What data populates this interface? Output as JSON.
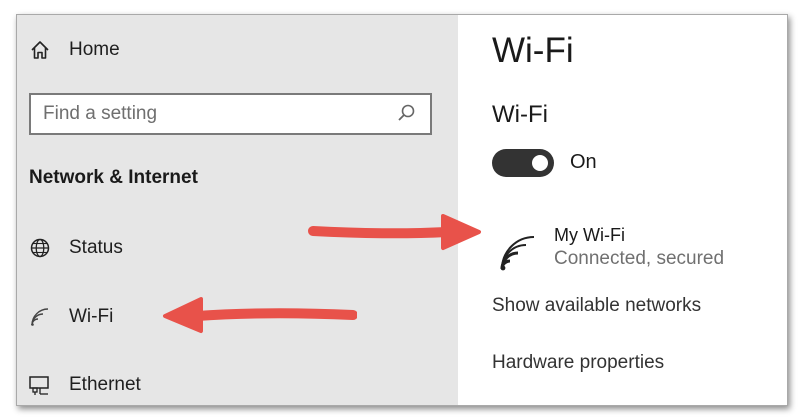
{
  "sidebar": {
    "home_label": "Home",
    "search_placeholder": "Find a setting",
    "section_title": "Network & Internet",
    "items": [
      {
        "label": "Status",
        "icon": "globe-icon"
      },
      {
        "label": "Wi-Fi",
        "icon": "wifi-icon"
      },
      {
        "label": "Ethernet",
        "icon": "ethernet-icon"
      }
    ]
  },
  "content": {
    "page_title": "Wi-Fi",
    "wifi_heading": "Wi-Fi",
    "toggle_state": "On",
    "network": {
      "name": "My Wi-Fi",
      "status": "Connected, secured"
    },
    "show_networks_link": "Show available networks",
    "hardware_link": "Hardware properties"
  },
  "colors": {
    "sidebar_bg": "#e6e6e6",
    "toggle_on": "#333333",
    "arrow": "#e8524a",
    "muted_text": "#707070"
  }
}
